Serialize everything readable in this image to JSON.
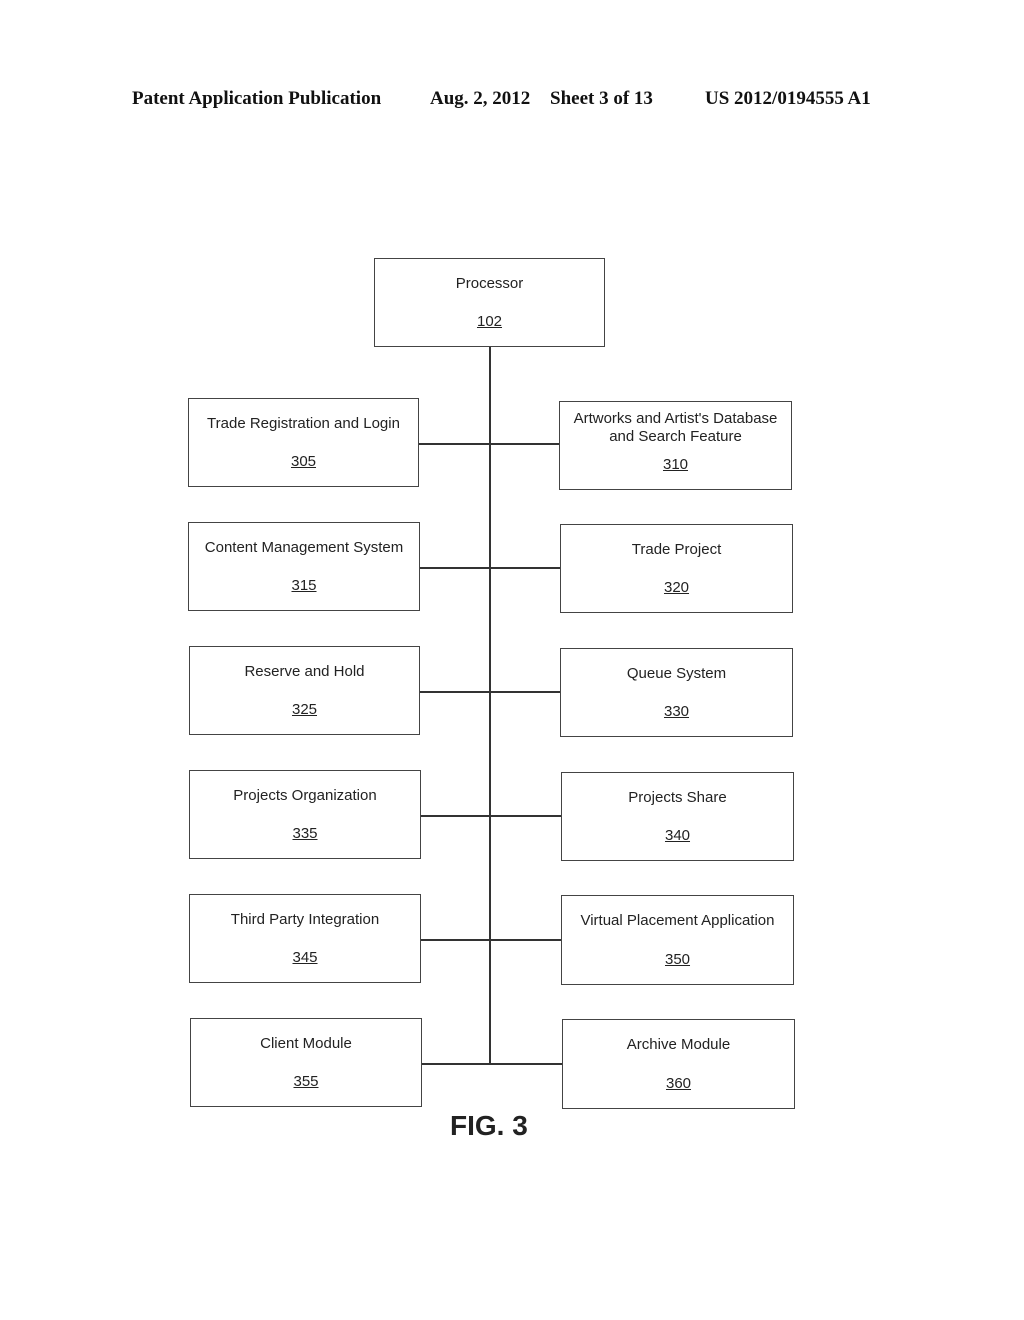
{
  "header": {
    "publication": "Patent Application Publication",
    "date": "Aug. 2, 2012",
    "sheet": "Sheet 3 of 13",
    "number": "US 2012/0194555 A1"
  },
  "processor": {
    "label": "Processor",
    "ref": "102"
  },
  "left_modules": [
    {
      "label": "Trade Registration and Login",
      "ref": "305"
    },
    {
      "label": "Content Management System",
      "ref": "315"
    },
    {
      "label": "Reserve and Hold",
      "ref": "325"
    },
    {
      "label": "Projects Organization",
      "ref": "335"
    },
    {
      "label": "Third Party Integration",
      "ref": "345"
    },
    {
      "label": "Client Module",
      "ref": "355"
    }
  ],
  "right_modules": [
    {
      "label": "Artworks and Artist's Database and Search Feature",
      "ref": "310"
    },
    {
      "label": "Trade Project",
      "ref": "320"
    },
    {
      "label": "Queue System",
      "ref": "330"
    },
    {
      "label": "Projects Share",
      "ref": "340"
    },
    {
      "label": "Virtual Placement Application",
      "ref": "350"
    },
    {
      "label": "Archive Module",
      "ref": "360"
    }
  ],
  "figure_label": "FIG. 3"
}
